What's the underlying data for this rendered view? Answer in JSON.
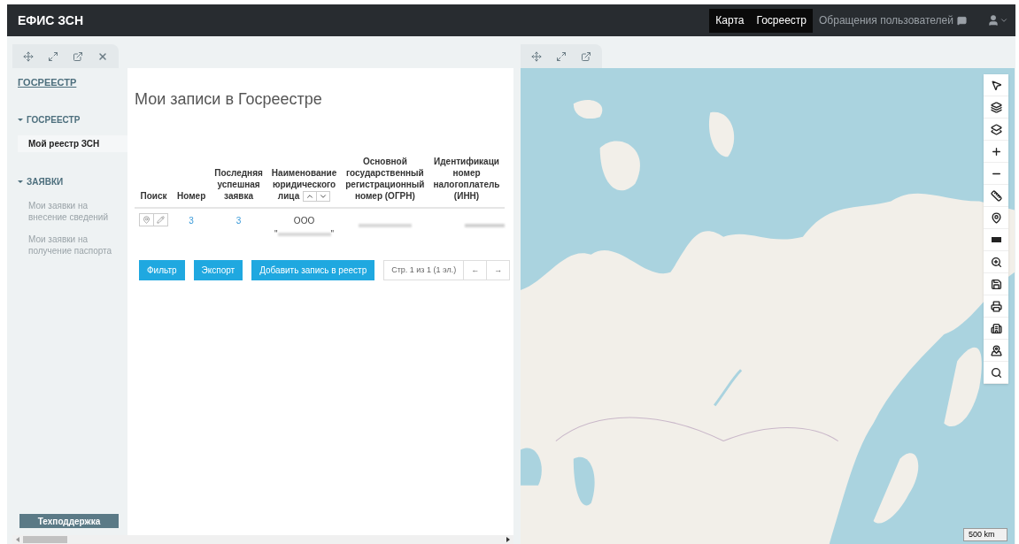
{
  "app_title": "ЕФИС ЗСН",
  "nav": [
    {
      "label": "Карта",
      "active": true
    },
    {
      "label": "Госреестр",
      "active": true
    },
    {
      "label": "Обращения пользователей",
      "active": false
    }
  ],
  "sidebar": {
    "title": "ГОСРЕЕСТР",
    "sections": [
      {
        "label": "ГОСРЕЕСТР",
        "expanded": true,
        "items": [
          {
            "label": "Мой реестр ЗСН",
            "selected": true
          }
        ]
      },
      {
        "label": "ЗАЯВКИ",
        "expanded": true,
        "items": [
          {
            "label": "Мои заявки на внесение сведений",
            "selected": false
          },
          {
            "label": "Мои заявки на получение паспорта",
            "selected": false
          }
        ]
      }
    ],
    "support_button": "Техподдержка"
  },
  "page_title": "Мои записи в Госреестре",
  "table": {
    "columns": [
      {
        "lines": [
          "Поиск"
        ]
      },
      {
        "lines": [
          "Номер"
        ]
      },
      {
        "lines": [
          "Последняя",
          "успешная",
          "заявка"
        ]
      },
      {
        "lines": [
          "Наименование",
          "юридического",
          "лица"
        ],
        "sortable": true
      },
      {
        "lines": [
          "Основной",
          "государственный",
          "регистрационный",
          "номер (ОГРН)"
        ]
      },
      {
        "lines": [
          "Идентификаци",
          "номер",
          "налогоплатель",
          "(ИНН)"
        ]
      }
    ],
    "rows": [
      {
        "number": "3",
        "last_request": "3",
        "name_line1": "ООО",
        "name_open_quote": "\"",
        "name_close_quote": "\""
      }
    ]
  },
  "buttons": [
    "Фильтр",
    "Экспорт",
    "Добавить запись в реестр"
  ],
  "pagination": {
    "info": "Стр. 1 из 1 (1 эл.)",
    "prev": "←",
    "next": "→"
  },
  "map": {
    "scale": "500 km"
  }
}
